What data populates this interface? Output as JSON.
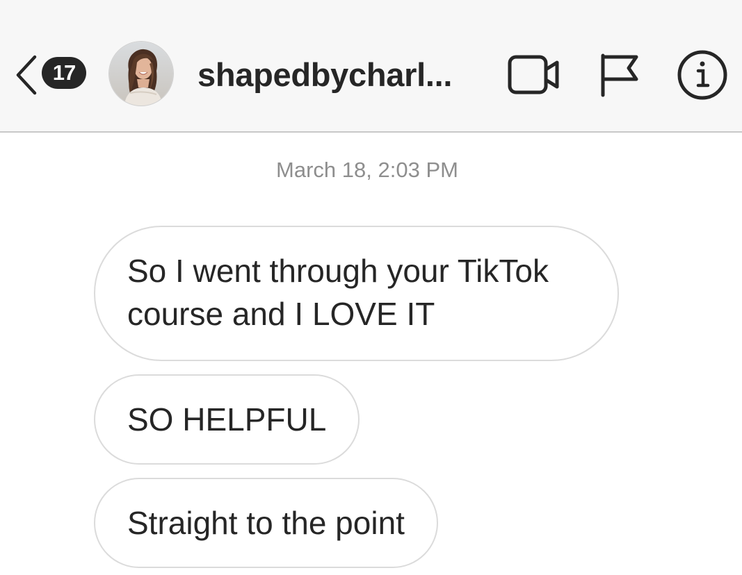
{
  "header": {
    "unread_count": "17",
    "username": "shapedbycharl...",
    "icons": {
      "back": "chevron-left-icon",
      "video": "video-camera-icon",
      "report": "flag-icon",
      "info": "info-icon"
    }
  },
  "thread": {
    "timestamp": "March 18, 2:03 PM",
    "messages": [
      {
        "text": "So I went through your TikTok course and I LOVE IT"
      },
      {
        "text": "SO HELPFUL"
      },
      {
        "text": "Straight to the point"
      }
    ]
  },
  "colors": {
    "header_bg": "#f7f7f7",
    "text": "#262626",
    "muted": "#8e8e8e",
    "bubble_border": "#dbdbdb"
  }
}
